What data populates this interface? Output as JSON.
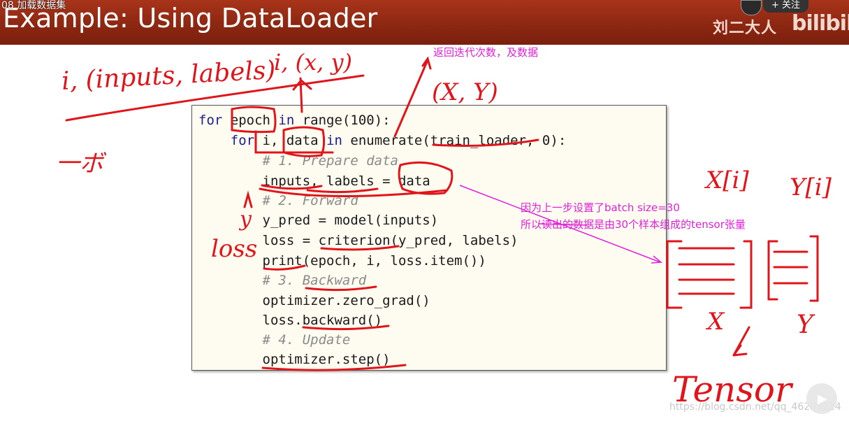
{
  "header": {
    "video_title": "08 加载数据集",
    "slide_title": "Example: Using DataLoader",
    "brand": "刘二大人",
    "logo": "bilibili",
    "follow_label": "+ 关注"
  },
  "code": {
    "lines": [
      "for epoch in range(100):",
      "    for i, data in enumerate(train_loader, 0):",
      "        # 1. Prepare data",
      "        inputs, labels = data",
      "        # 2. Forward",
      "        y_pred = model(inputs)",
      "        loss = criterion(y_pred, labels)",
      "        print(epoch, i, loss.item())",
      "        # 3. Backward",
      "        optimizer.zero_grad()",
      "        loss.backward()",
      "        # 4. Update",
      "        optimizer.step()"
    ]
  },
  "annotations": {
    "note_top": "返回迭代次数，及数据",
    "note_batch_1": "因为上一步设置了batch size=30",
    "note_batch_2": "所以读出的数据是由30个样本组成的tensor张量",
    "hand_i_inputs": "i, (inputs, labels)",
    "hand_ix_y": "i, (x, y)",
    "hand_xy_right": "(X, Y)",
    "hand_yi_dash": "一ボ",
    "hand_xi": "X[i]",
    "hand_yi": "Y[i]",
    "hand_loss": "loss",
    "hand_y_small": "y",
    "hand_x_mark": "X",
    "hand_y_mark": "Y",
    "hand_tensor": "Tensor"
  },
  "watermark": "https://blog.csdn.net/qq_46209224"
}
